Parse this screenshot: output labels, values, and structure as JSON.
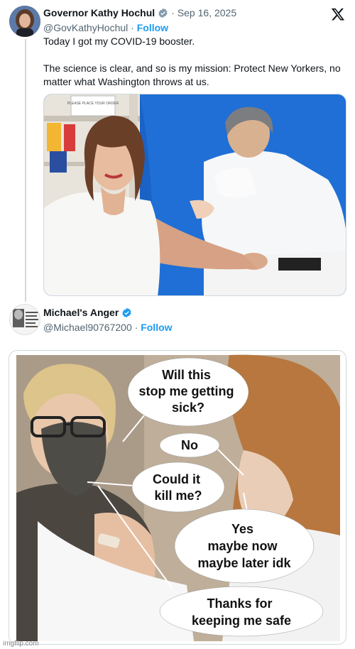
{
  "tweet1": {
    "name": "Governor Kathy Hochul",
    "date": "Sep 16, 2025",
    "handle": "@GovKathyHochul",
    "separator": "·",
    "follow": "Follow",
    "text_line1": "Today I got my COVID-19 booster.",
    "text_line2": "The science is clear, and so is my mission: Protect New Yorkers, no matter what Washington throws at us."
  },
  "tweet2": {
    "name": "Michael's Anger",
    "handle": "@Michael90767200",
    "separator": "·",
    "follow": "Follow",
    "avatar_text": "THE MICHAEL'S ANGER DAILY REPORT"
  },
  "meme": {
    "bubble1": [
      "Will this",
      "stop me getting",
      "sick?"
    ],
    "bubble2": [
      "No"
    ],
    "bubble3": [
      "Could it",
      "kill me?"
    ],
    "bubble4": [
      "Yes",
      "maybe now",
      "maybe later idk"
    ],
    "bubble5": [
      "Thanks for",
      "keeping me safe"
    ]
  },
  "photo1_sign": "PLEASE PLACE YOUR ORDER",
  "watermark": "imgflip.com",
  "colors": {
    "accent": "#1d9bf0",
    "text": "#0f1419",
    "muted": "#536471",
    "border": "#cfd9de"
  },
  "icons": [
    "x-logo-icon",
    "verified-badge-icon"
  ]
}
